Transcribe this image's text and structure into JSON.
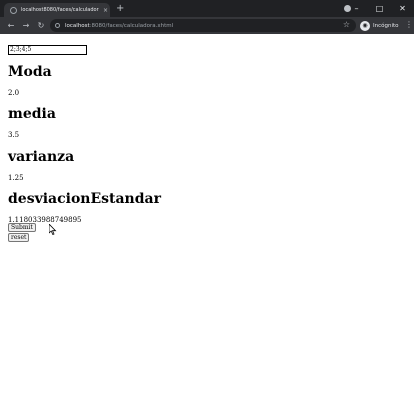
{
  "browser": {
    "tab_title": "localhost8080/faces/calculadora",
    "tab_close": "×",
    "new_tab": "+",
    "url_host": "localhost",
    "url_rest": ":8080/faces/calculadora.xhtml",
    "profile_label": "Incógnito",
    "window_minimize": "–",
    "window_maximize": "□",
    "window_close": "✕"
  },
  "page": {
    "input_value": "2;3;4;5",
    "moda_label": "Moda",
    "moda_value": "2.0",
    "media_label": "media",
    "media_value": "3.5",
    "varianza_label": "varianza",
    "varianza_value": "1.25",
    "desviacion_label": "desviacionEstandar",
    "desviacion_value": "1.118033988749895",
    "submit_label": "Submit",
    "reset_label": "reset"
  }
}
